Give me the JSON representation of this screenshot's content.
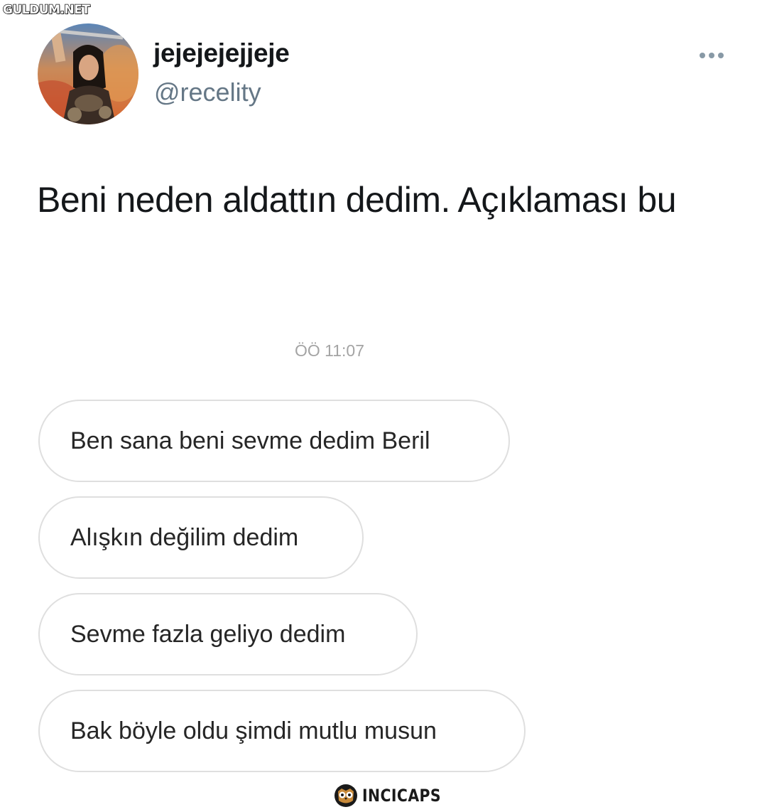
{
  "watermark": {
    "top_left": "GULDUM.NET",
    "bottom": "INCICAPS"
  },
  "tweet": {
    "display_name": "jejejejejjeje",
    "handle": "@recelity",
    "text": "Beni neden aldattın dedim. Açıklaması bu"
  },
  "chat": {
    "timestamp": "ÖÖ 11:07",
    "messages": [
      "Ben sana beni sevme dedim Beril",
      "Alışkın değilim dedim",
      "Sevme fazla geliyo dedim",
      "Bak böyle oldu şimdi mutlu musun"
    ]
  },
  "colors": {
    "handle": "#657786",
    "text": "#14171a",
    "bubble_border": "#dfdfdf",
    "timestamp": "#a4a4a4"
  },
  "icons": {
    "more": "more-horizontal-icon",
    "brand": "owl-logo-icon"
  }
}
